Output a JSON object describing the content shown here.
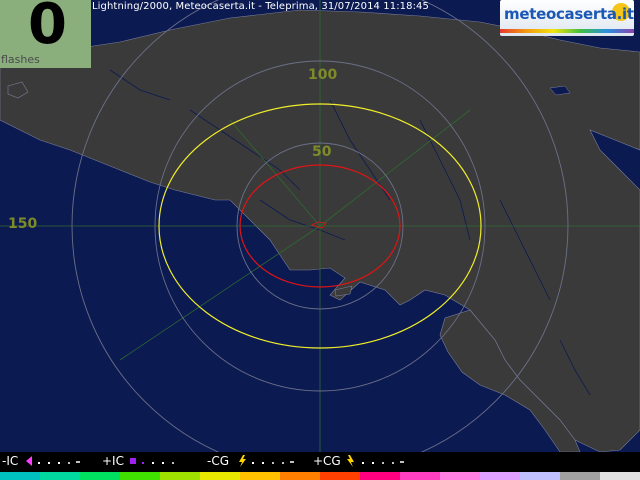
{
  "header": {
    "title": "Lightning/2000, Meteocaserta.it - Teleprima, 31/07/2014 11:18:45"
  },
  "counter": {
    "value": "0",
    "label": "flashes"
  },
  "logo": {
    "text": "meteocaserta.it"
  },
  "range_rings": [
    {
      "label": "100"
    },
    {
      "label": "50"
    },
    {
      "label": "150"
    }
  ],
  "legend": {
    "items": [
      {
        "label": "-IC",
        "marker_color": "#ff3cff"
      },
      {
        "label": "+IC",
        "marker_color": "#a020f0"
      },
      {
        "label": "-CG",
        "marker_color": "#ffd400"
      },
      {
        "label": "+CG",
        "marker_color": "#ffd400"
      }
    ]
  },
  "colors": {
    "sea": "#0c1a52",
    "land": "#3a3a3a",
    "rings": "#6b7088",
    "inner_alert_ring": "#e01414",
    "outer_alert_ring": "#f0ee2a",
    "grid": "#2f6a2f",
    "age_scale": [
      "#00c0c0",
      "#00d8a0",
      "#00e060",
      "#40e000",
      "#a0e000",
      "#e8e800",
      "#ffc000",
      "#ff8000",
      "#ff4000",
      "#ff0080",
      "#ff40c0",
      "#ff80e0",
      "#e0a0ff",
      "#c0c0ff",
      "#a0a0a0",
      "#e0e0e0"
    ]
  }
}
